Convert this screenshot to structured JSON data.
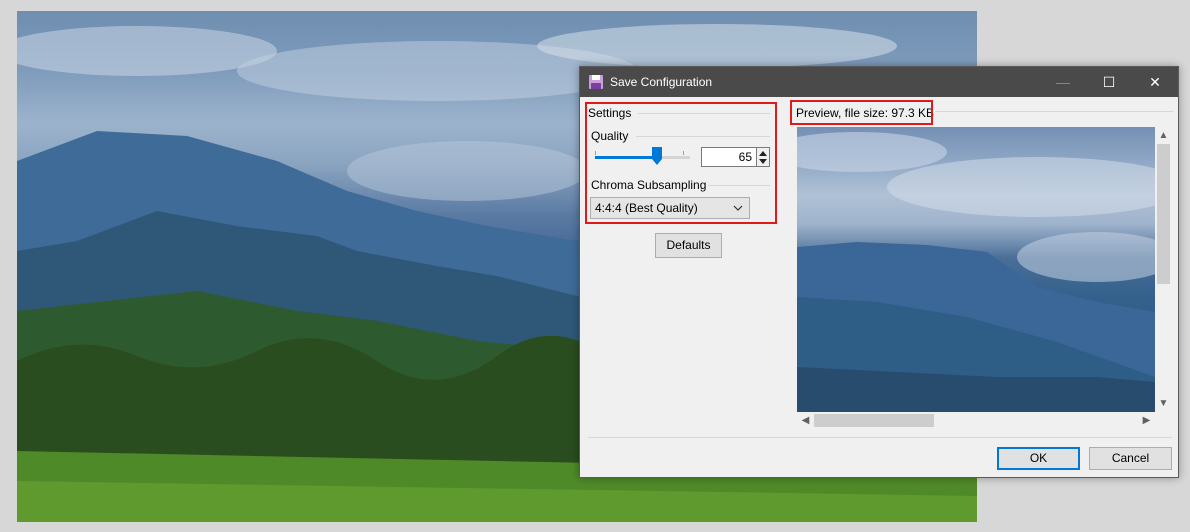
{
  "dialog": {
    "title": "Save Configuration",
    "controls": {
      "minimize": "—",
      "maximize": "☐",
      "close": "✕"
    }
  },
  "settings": {
    "group_label": "Settings",
    "quality_label": "Quality",
    "quality_value": "65",
    "quality_slider_level": 0.65,
    "chroma_label": "Chroma Subsampling",
    "chroma_selected": "4:4:4 (Best Quality)",
    "defaults_button": "Defaults"
  },
  "preview": {
    "label": "Preview, file size: 97.3 KB"
  },
  "footer": {
    "ok_button": "OK",
    "cancel_button": "Cancel"
  },
  "colors": {
    "highlight": "#e0191a",
    "accent": "#0078d7",
    "titlebar": "#4a4a4a"
  }
}
